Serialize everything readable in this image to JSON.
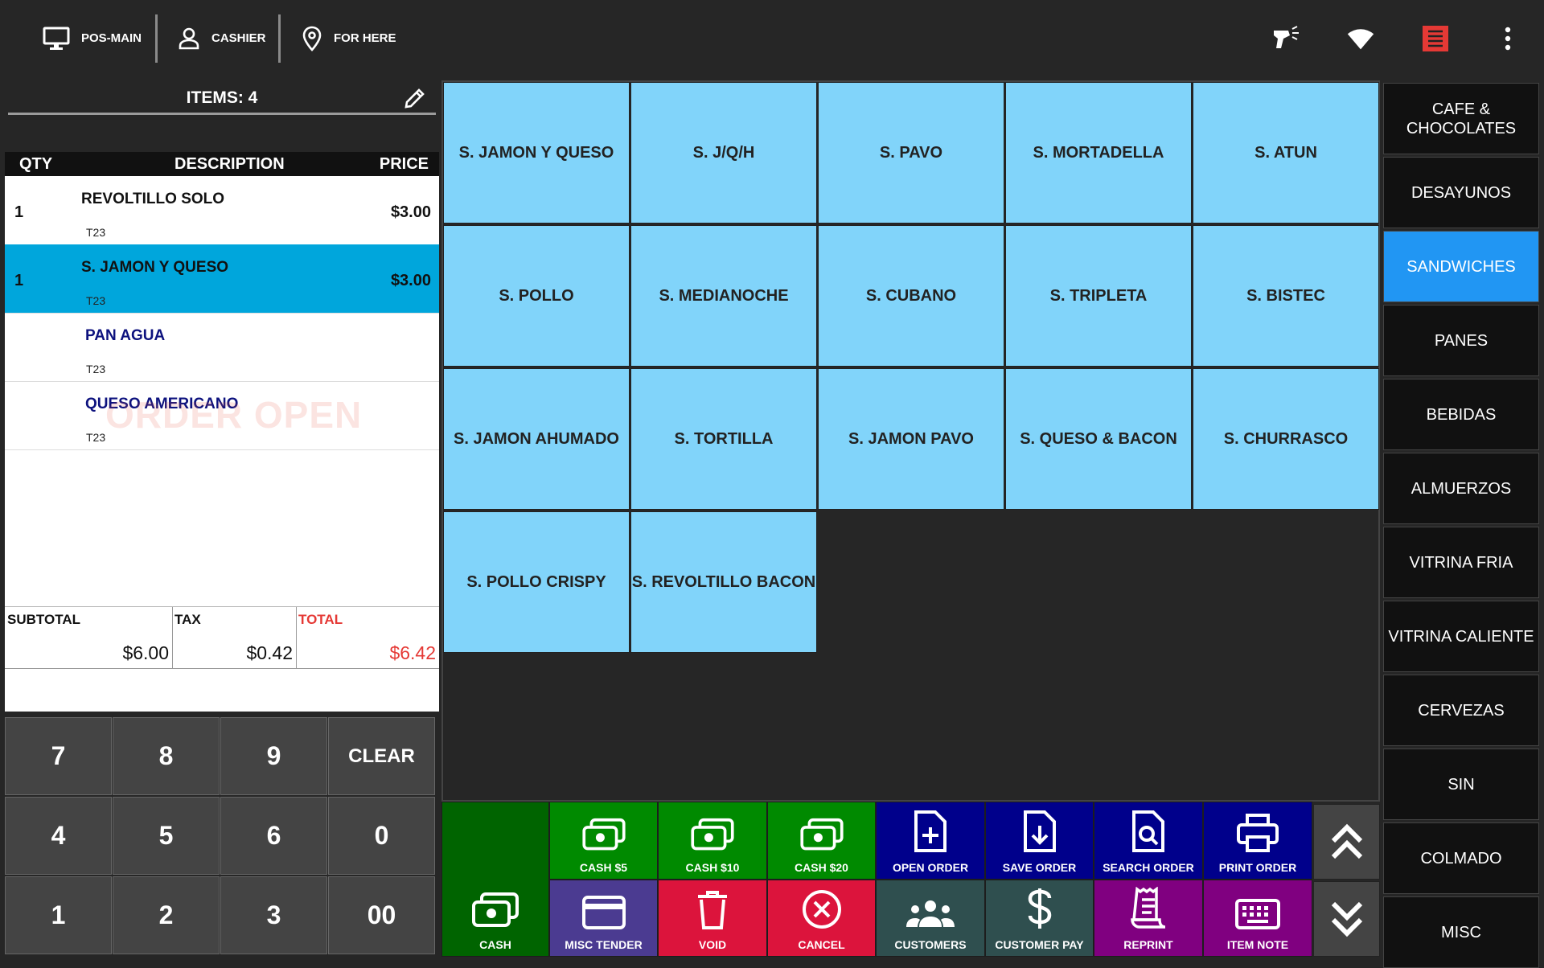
{
  "topbar": {
    "station": "POS-MAIN",
    "user": "CASHIER",
    "order_type": "FOR HERE",
    "icons": [
      "monitor-icon",
      "person-icon",
      "location-icon",
      "barcode-scanner-icon",
      "wifi-icon",
      "receipt-printer-icon",
      "more-vert-icon"
    ],
    "printer_status_color": "#e53935"
  },
  "order": {
    "items_label": "ITEMS: 4",
    "columns": {
      "qty": "QTY",
      "description": "DESCRIPTION",
      "price": "PRICE"
    },
    "lines": [
      {
        "qty": "1",
        "description": "REVOLTILLO SOLO",
        "price": "$3.00",
        "tag": "T23"
      },
      {
        "qty": "1",
        "description": "S. JAMON Y QUESO",
        "price": "$3.00",
        "tag": "T23"
      },
      {
        "qty": "",
        "description": "PAN AGUA",
        "price": "",
        "tag": "T23"
      },
      {
        "qty": "",
        "description": "QUESO AMERICANO",
        "price": "",
        "tag": "T23"
      }
    ],
    "watermark": "ORDER OPEN",
    "totals": {
      "subtotal_label": "SUBTOTAL",
      "subtotal": "$6.00",
      "tax_label": "TAX",
      "tax": "$0.42",
      "total_label": "TOTAL",
      "total": "$6.42"
    }
  },
  "keypad": [
    "7",
    "8",
    "9",
    "CLEAR",
    "4",
    "5",
    "6",
    "0",
    "1",
    "2",
    "3",
    "00"
  ],
  "products": [
    "S. JAMON Y QUESO",
    "S. J/Q/H",
    "S. PAVO",
    "S. MORTADELLA",
    "S. ATUN",
    "S. POLLO",
    "S. MEDIANOCHE",
    "S. CUBANO",
    "S. TRIPLETA",
    "S. BISTEC",
    "S. JAMON AHUMADO",
    "S. TORTILLA",
    "S. JAMON PAVO",
    "S. QUESO & BACON",
    "S. CHURRASCO",
    "S. POLLO CRISPY",
    "S. REVOLTILLO BACON"
  ],
  "categories": [
    "CAFE &\nCHOCOLATES",
    "DESAYUNOS",
    "SANDWICHES",
    "PANES",
    "BEBIDAS",
    "ALMUERZOS",
    "VITRINA FRIA",
    "VITRINA CALIENTE",
    "CERVEZAS",
    "SIN",
    "COLMADO",
    "MISC"
  ],
  "active_category": "SANDWICHES",
  "actions": {
    "cash": "CASH",
    "cash5": "CASH $5",
    "cash10": "CASH $10",
    "cash20": "CASH $20",
    "open_order": "OPEN ORDER",
    "save_order": "SAVE ORDER",
    "search_order": "SEARCH ORDER",
    "print_order": "PRINT ORDER",
    "misc_tender": "MISC TENDER",
    "void": "VOID",
    "cancel": "CANCEL",
    "customers": "CUSTOMERS",
    "customer_pay": "CUSTOMER PAY",
    "reprint": "REPRINT",
    "item_note": "ITEM NOTE"
  },
  "colors": {
    "product_tile": "#81d4fa",
    "selected_line": "#00a6dc",
    "active_category": "#2196f3",
    "cash_green": "#008a00",
    "cash_dark_green": "#006400",
    "order_navy": "#00008b",
    "misc_tender": "#4b3b91",
    "void_red": "#dc143c",
    "slate": "#2f4f4f",
    "purple": "#800080",
    "total_red": "#e53935"
  }
}
